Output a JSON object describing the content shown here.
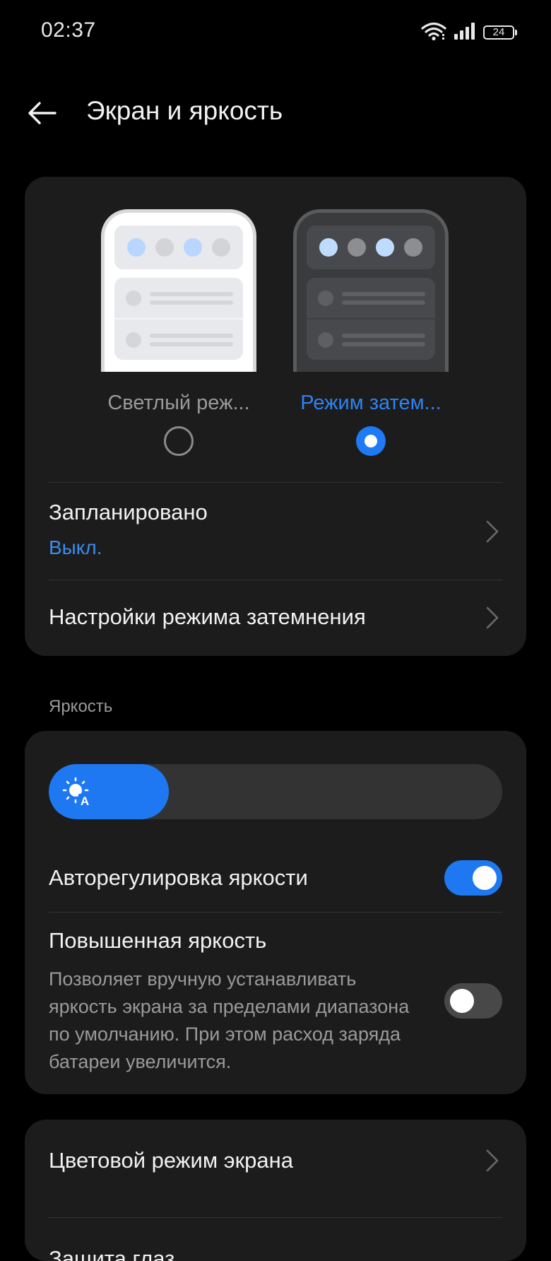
{
  "status_bar": {
    "time": "02:37",
    "battery": "24",
    "icons": [
      "wifi-icon",
      "signal-icon",
      "battery-icon"
    ]
  },
  "header": {
    "title": "Экран и яркость",
    "back_icon": "arrow-left-icon"
  },
  "display_mode": {
    "light_label": "Светлый реж...",
    "dark_label": "Режим затем...",
    "selected": "dark"
  },
  "scheduled": {
    "title": "Запланировано",
    "value": "Выкл."
  },
  "dark_mode_settings": {
    "title": "Настройки режима затемнения"
  },
  "brightness": {
    "section_label": "Яркость",
    "level_fraction": 0.265,
    "auto_label": "Авторегулировка яркости",
    "auto_enabled": true,
    "boost_title": "Повышенная яркость",
    "boost_description": "Позволяет вручную устанавливать яркость экрана за пределами диапазона по умолчанию. При этом расход заряда батареи увеличится.",
    "boost_enabled": false
  },
  "color_mode": {
    "title": "Цветовой режим экрана",
    "next_partial": "Защита глаз"
  },
  "colors": {
    "accent": "#1e78f2",
    "link": "#3b8bf2",
    "card": "#1c1c1c",
    "background": "#000000"
  }
}
